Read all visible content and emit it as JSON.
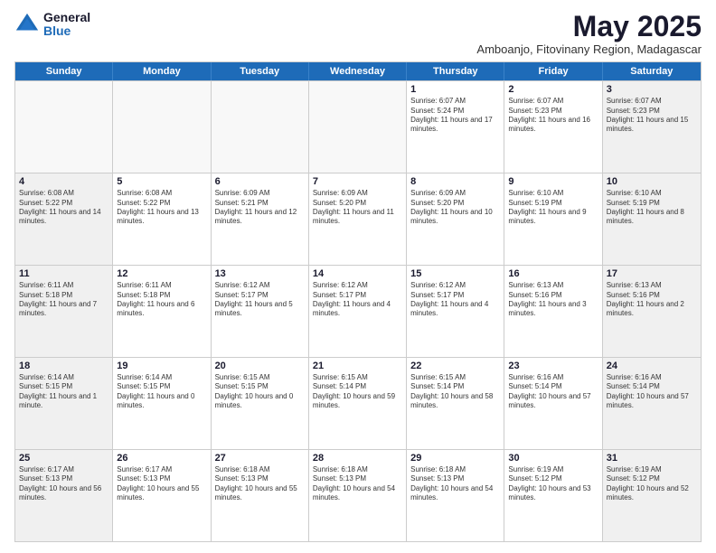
{
  "logo": {
    "general": "General",
    "blue": "Blue"
  },
  "title": "May 2025",
  "subtitle": "Amboanjo, Fitovinany Region, Madagascar",
  "weekdays": [
    "Sunday",
    "Monday",
    "Tuesday",
    "Wednesday",
    "Thursday",
    "Friday",
    "Saturday"
  ],
  "rows": [
    [
      {
        "day": "",
        "empty": true
      },
      {
        "day": "",
        "empty": true
      },
      {
        "day": "",
        "empty": true
      },
      {
        "day": "",
        "empty": true
      },
      {
        "day": "1",
        "sunrise": "6:07 AM",
        "sunset": "5:24 PM",
        "daylight": "11 hours and 17 minutes."
      },
      {
        "day": "2",
        "sunrise": "6:07 AM",
        "sunset": "5:23 PM",
        "daylight": "11 hours and 16 minutes."
      },
      {
        "day": "3",
        "sunrise": "6:07 AM",
        "sunset": "5:23 PM",
        "daylight": "11 hours and 15 minutes.",
        "shaded": true
      }
    ],
    [
      {
        "day": "4",
        "sunrise": "6:08 AM",
        "sunset": "5:22 PM",
        "daylight": "11 hours and 14 minutes.",
        "shaded": true
      },
      {
        "day": "5",
        "sunrise": "6:08 AM",
        "sunset": "5:22 PM",
        "daylight": "11 hours and 13 minutes."
      },
      {
        "day": "6",
        "sunrise": "6:09 AM",
        "sunset": "5:21 PM",
        "daylight": "11 hours and 12 minutes."
      },
      {
        "day": "7",
        "sunrise": "6:09 AM",
        "sunset": "5:20 PM",
        "daylight": "11 hours and 11 minutes."
      },
      {
        "day": "8",
        "sunrise": "6:09 AM",
        "sunset": "5:20 PM",
        "daylight": "11 hours and 10 minutes."
      },
      {
        "day": "9",
        "sunrise": "6:10 AM",
        "sunset": "5:19 PM",
        "daylight": "11 hours and 9 minutes."
      },
      {
        "day": "10",
        "sunrise": "6:10 AM",
        "sunset": "5:19 PM",
        "daylight": "11 hours and 8 minutes.",
        "shaded": true
      }
    ],
    [
      {
        "day": "11",
        "sunrise": "6:11 AM",
        "sunset": "5:18 PM",
        "daylight": "11 hours and 7 minutes.",
        "shaded": true
      },
      {
        "day": "12",
        "sunrise": "6:11 AM",
        "sunset": "5:18 PM",
        "daylight": "11 hours and 6 minutes."
      },
      {
        "day": "13",
        "sunrise": "6:12 AM",
        "sunset": "5:17 PM",
        "daylight": "11 hours and 5 minutes."
      },
      {
        "day": "14",
        "sunrise": "6:12 AM",
        "sunset": "5:17 PM",
        "daylight": "11 hours and 4 minutes."
      },
      {
        "day": "15",
        "sunrise": "6:12 AM",
        "sunset": "5:17 PM",
        "daylight": "11 hours and 4 minutes."
      },
      {
        "day": "16",
        "sunrise": "6:13 AM",
        "sunset": "5:16 PM",
        "daylight": "11 hours and 3 minutes."
      },
      {
        "day": "17",
        "sunrise": "6:13 AM",
        "sunset": "5:16 PM",
        "daylight": "11 hours and 2 minutes.",
        "shaded": true
      }
    ],
    [
      {
        "day": "18",
        "sunrise": "6:14 AM",
        "sunset": "5:15 PM",
        "daylight": "11 hours and 1 minute.",
        "shaded": true
      },
      {
        "day": "19",
        "sunrise": "6:14 AM",
        "sunset": "5:15 PM",
        "daylight": "11 hours and 0 minutes."
      },
      {
        "day": "20",
        "sunrise": "6:15 AM",
        "sunset": "5:15 PM",
        "daylight": "10 hours and 0 minutes."
      },
      {
        "day": "21",
        "sunrise": "6:15 AM",
        "sunset": "5:14 PM",
        "daylight": "10 hours and 59 minutes."
      },
      {
        "day": "22",
        "sunrise": "6:15 AM",
        "sunset": "5:14 PM",
        "daylight": "10 hours and 58 minutes."
      },
      {
        "day": "23",
        "sunrise": "6:16 AM",
        "sunset": "5:14 PM",
        "daylight": "10 hours and 57 minutes."
      },
      {
        "day": "24",
        "sunrise": "6:16 AM",
        "sunset": "5:14 PM",
        "daylight": "10 hours and 57 minutes.",
        "shaded": true
      }
    ],
    [
      {
        "day": "25",
        "sunrise": "6:17 AM",
        "sunset": "5:13 PM",
        "daylight": "10 hours and 56 minutes.",
        "shaded": true
      },
      {
        "day": "26",
        "sunrise": "6:17 AM",
        "sunset": "5:13 PM",
        "daylight": "10 hours and 55 minutes."
      },
      {
        "day": "27",
        "sunrise": "6:18 AM",
        "sunset": "5:13 PM",
        "daylight": "10 hours and 55 minutes."
      },
      {
        "day": "28",
        "sunrise": "6:18 AM",
        "sunset": "5:13 PM",
        "daylight": "10 hours and 54 minutes."
      },
      {
        "day": "29",
        "sunrise": "6:18 AM",
        "sunset": "5:13 PM",
        "daylight": "10 hours and 54 minutes."
      },
      {
        "day": "30",
        "sunrise": "6:19 AM",
        "sunset": "5:12 PM",
        "daylight": "10 hours and 53 minutes."
      },
      {
        "day": "31",
        "sunrise": "6:19 AM",
        "sunset": "5:12 PM",
        "daylight": "10 hours and 52 minutes.",
        "shaded": true
      }
    ]
  ]
}
